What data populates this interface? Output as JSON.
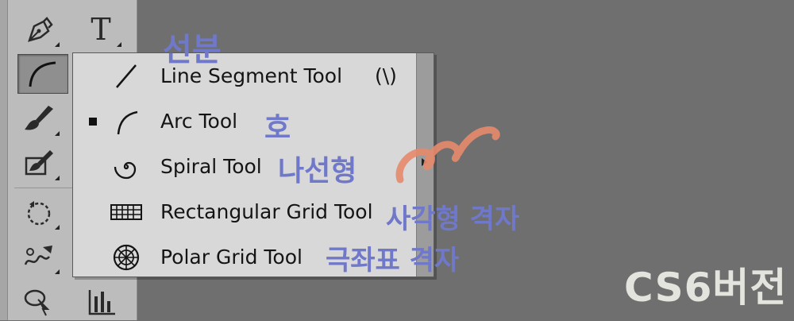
{
  "toolbar": {
    "tools": [
      {
        "name": "pen-tool",
        "icon": "pen-icon"
      },
      {
        "name": "type-tool",
        "icon": "type-icon",
        "glyph": "T"
      },
      {
        "name": "arc-tool",
        "icon": "arc-icon",
        "active": true
      },
      {
        "name": "paintbrush-tool",
        "icon": "paintbrush-icon"
      },
      {
        "name": "blob-brush-tool",
        "icon": "blob-brush-icon"
      },
      {
        "name": "rotate-tool",
        "icon": "rotate-icon"
      },
      {
        "name": "warp-tool",
        "icon": "warp-icon"
      },
      {
        "name": "shape-builder-tool",
        "icon": "shape-builder-icon"
      },
      {
        "name": "graph-tool",
        "icon": "graph-icon"
      }
    ]
  },
  "flyout": {
    "items": [
      {
        "label": "Line Segment Tool",
        "shortcut": "(\\)",
        "icon": "line-segment-icon",
        "selected": false
      },
      {
        "label": "Arc Tool",
        "icon": "arc-icon",
        "selected": true
      },
      {
        "label": "Spiral Tool",
        "icon": "spiral-icon",
        "selected": false
      },
      {
        "label": "Rectangular Grid Tool",
        "icon": "rectangular-grid-icon",
        "selected": false
      },
      {
        "label": "Polar Grid Tool",
        "icon": "polar-grid-icon",
        "selected": false
      }
    ],
    "tearoff_icon": "triangle-right-icon"
  },
  "annotations": {
    "line_segment": "선분",
    "arc": "호",
    "spiral": "나선형",
    "rect_grid": "사각형 격자",
    "polar_grid": "극좌표 격자",
    "version": "CS6버전"
  },
  "colors": {
    "annotation_text": "#6f78c9",
    "scribble": "#e58a6a",
    "version_text": "#e4e4de",
    "canvas_bg": "#6f6f6f",
    "panel_bg": "#bcbcbc",
    "menu_bg": "#d8d8d8"
  }
}
